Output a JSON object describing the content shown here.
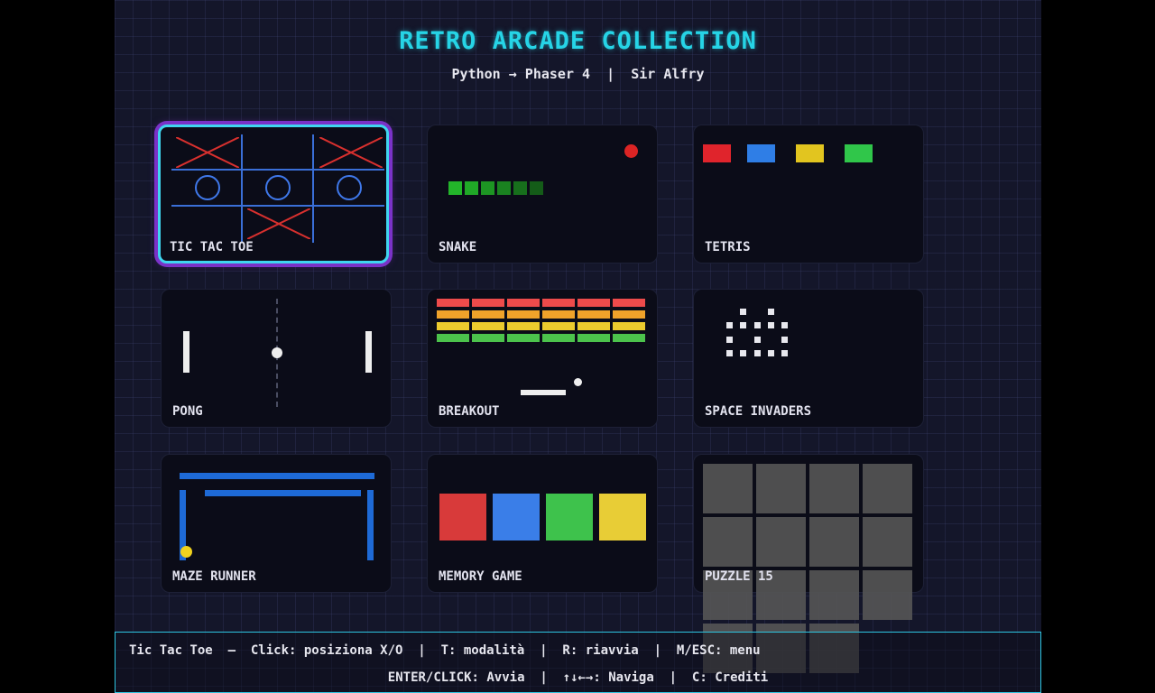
{
  "header": {
    "title": "RETRO ARCADE COLLECTION",
    "subtitle": "Python → Phaser 4  |  Sir Alfry"
  },
  "games": [
    {
      "label": "TIC TAC TOE",
      "selected": true
    },
    {
      "label": "SNAKE"
    },
    {
      "label": "TETRIS"
    },
    {
      "label": "PONG"
    },
    {
      "label": "BREAKOUT"
    },
    {
      "label": "SPACE INVADERS"
    },
    {
      "label": "MAZE RUNNER"
    },
    {
      "label": "MEMORY GAME"
    },
    {
      "label": "PUZZLE 15"
    }
  ],
  "footer": {
    "line1": "Tic Tac Toe  —  Click: posiziona X/O  |  T: modalità  |  R: riavvia  |  M/ESC: menu",
    "line2": "ENTER/CLICK: Avvia  |  ↑↓←→: Naviga  |  C: Crediti"
  },
  "colors": {
    "accent_cyan": "#26d4e6",
    "selection_purple": "#7a32c8",
    "background": "#14162a",
    "card": "#0b0c18"
  }
}
